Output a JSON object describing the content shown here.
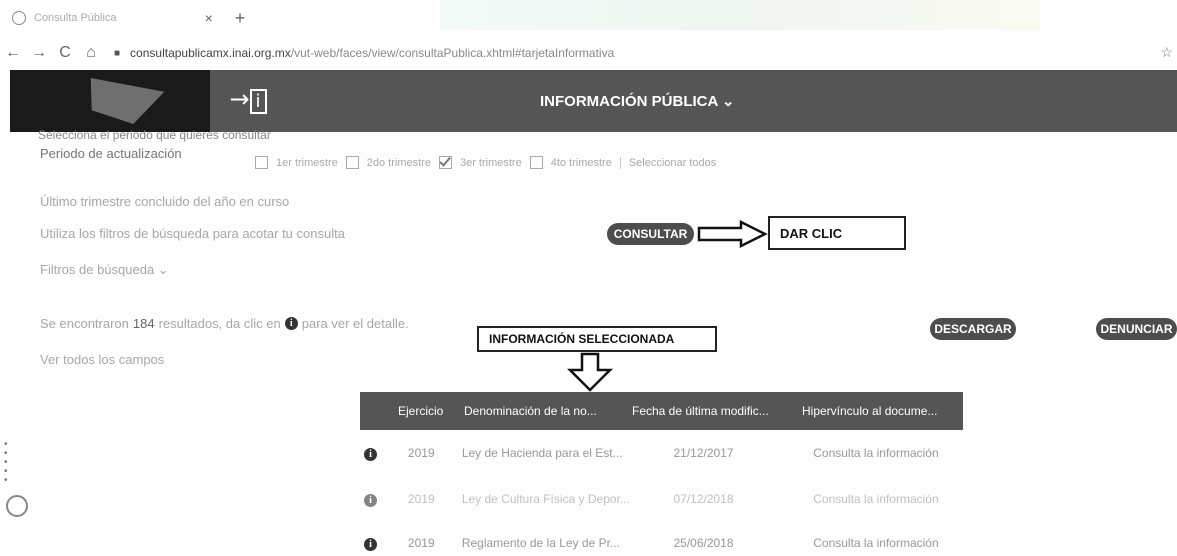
{
  "browser": {
    "tab_title": "Consulta Pública",
    "tab_close": "×",
    "tab_new": "+",
    "url_host": "consultapublicamx.inai.org.mx",
    "url_path": "/vut-web/faces/view/consultaPublica.xhtml#tarjetaInformativa",
    "back": "←",
    "forward": "→",
    "reload": "C",
    "home": "⌂",
    "star": "☆"
  },
  "header": {
    "login_icon": "→i",
    "menu_title": "INFORMACIÓN PÚBLICA ⌄"
  },
  "filters": {
    "ghost_text": "Selecciona el periodo que quieres consultar",
    "period_label": "Periodo de actualización",
    "quarters": [
      "1er trimestre",
      "2do trimestre",
      "3er trimestre",
      "4to trimestre"
    ],
    "checked_index": 2,
    "select_all": "Seleccionar todos",
    "last_quarter_note": "Último trimestre concluido del año en curso",
    "filter_hint": "Utiliza los filtros de búsqueda para acotar tu consulta",
    "filters_toggle": "Filtros de búsqueda ⌄"
  },
  "actions": {
    "consultar": "CONSULTAR",
    "dar_clic": "DAR CLIC",
    "seleccionada": "INFORMACIÓN SELECCIONADA",
    "descargar": "DESCARGAR",
    "denunciar": "DENUNCIAR"
  },
  "results": {
    "summary_pre": "Se encontraron",
    "count": "184",
    "summary_post": "resultados, da clic en",
    "summary_end": "para ver el detalle.",
    "view_all": "Ver todos los campos"
  },
  "table": {
    "headers": [
      "Ejercicio",
      "Denominación de la no...",
      "Fecha de última modific...",
      "Hipervínculo al docume..."
    ],
    "rows": [
      {
        "year": "2019",
        "name": "Ley de Hacienda para el Est...",
        "date": "21/12/2017",
        "link": "Consulta la información"
      },
      {
        "year": "2019",
        "name": "Ley de Cultura Física y Depor...",
        "date": "07/12/2018",
        "link": "Consulta la información"
      },
      {
        "year": "2019",
        "name": "Reglamento de la Ley de Pr...",
        "date": "25/06/2018",
        "link": "Consulta la información"
      }
    ]
  }
}
